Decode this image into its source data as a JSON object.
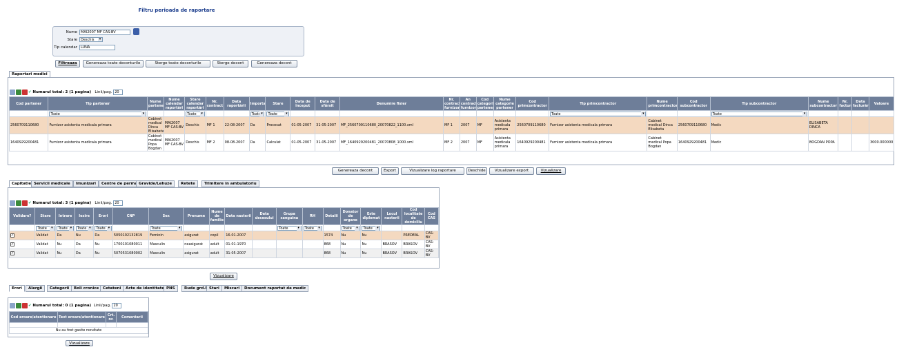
{
  "title": "Filtru perioada de raportare",
  "filter": {
    "nume_label": "Nume",
    "nume_value": "MAI2007 MF CAS-BV",
    "stare_label": "Stare",
    "stare_value": "Deschis",
    "tipcal_label": "Tip calendar",
    "tipcal_value": "LUNA"
  },
  "actions": [
    "Filtreaza",
    "Genereaza toate deconturile",
    "Sterge toate deconturile",
    "Sterge decont",
    "Genereaza decont"
  ],
  "main_tab": "Raportari medici",
  "grid1": {
    "total": "Numarul total: 2 (1 pagina)",
    "linii_label": "Linii/pag.",
    "linii_value": "20",
    "headers": [
      "Cod partener",
      "Tip partener",
      "Nume partener",
      "Nume calendar raportări",
      "Stare calendar raportări",
      "Nr. contract",
      "Data raportării",
      "Importat",
      "Stare",
      "Data de început",
      "Data de sfârsit",
      "Denumire fisier",
      "Nr. contract furnizor",
      "An contract furnizor",
      "Cod categorie partener",
      "Nume categorie partener",
      "Cod primcontractor",
      "Tip primcontractor",
      "Nume primcontractor",
      "Cod subcontractor",
      "Tip subcontractor",
      "Nume subcontractor",
      "Nr. factură",
      "Data facturări",
      "Valoare"
    ],
    "filters": {
      "1": "Toate",
      "4": "Toate",
      "7": "Toate",
      "8": "Toate",
      "17": "Toate",
      "20": "Toate"
    },
    "rows": [
      [
        "2560709110680",
        "Furnizor asistenta medicala primara",
        "Cabinet medical Dinca Elisabeta",
        "MAI2007 MF CAS-BV",
        "Deschis",
        "MF 1",
        "22-08-2007",
        "Da",
        "Procesat",
        "01-05-2007",
        "31-05-2007",
        "MF_2560709110680_20070822_1100.xml",
        "MF 1",
        "2007",
        "MF",
        "Asistenta medicala primara",
        "2560709110680",
        "Furnizor asistenta medicala primara",
        "Cabinet medical Dinca Elisabeta",
        "2560709110680",
        "Medic",
        "ELISABETA DINCA",
        "",
        "",
        ""
      ],
      [
        "1640929200481",
        "Furnizor asistenta medicala primara",
        "Cabinet medical Popa Bogdan",
        "MAI2007 MF CAS-BV",
        "Deschis",
        "MF 2",
        "08-08-2007",
        "Da",
        "Calculat",
        "01-05-2007",
        "31-05-2007",
        "MF_1640929200481_20070808_1000.xml",
        "MF 2",
        "2007",
        "MF",
        "Asistenta medicala primara",
        "1640929200481",
        "Furnizor asistenta medicala primara",
        "Cabinet medical Popa Bogdan",
        "1640929200481",
        "Medic",
        "BOGDAN POPA",
        "",
        "",
        "3000.000000"
      ]
    ]
  },
  "actions2": [
    "Genereaza decont",
    "Export",
    "Vizualizare log raportare",
    "Deschide",
    "Vizualizare export",
    "Vizualizare"
  ],
  "tabs2": [
    "Capitatie",
    "Servicii medicale",
    "Imunizari",
    "Centre de permanenta",
    "Gravide/Lehuze",
    "Retete",
    "Trimitere in ambulatoriu"
  ],
  "grid2": {
    "total": "Numarul total: 3 (1 pagina)",
    "linii_label": "Linii/pag.",
    "linii_value": "20",
    "headers": [
      "Validare?",
      "Stare",
      "Intrare",
      "Iesire",
      "Erori",
      "CNP",
      "Sex",
      "Prenume",
      "Nume de familie",
      "Data nasterii",
      "Data decesului",
      "Grupa sanguina",
      "RH",
      "Detalii",
      "Donator de organe",
      "Este diplomat",
      "Locul nasterii",
      "Cod localitate de domiciliu",
      "Cod CAS"
    ],
    "filters": {
      "1": "Toate",
      "2": "Toate",
      "3": "Toate",
      "4": "Toate",
      "6": "Toate",
      "11": "Toate",
      "12": "Toate",
      "14": "Toate",
      "15": "Toate"
    },
    "rows": [
      [
        "✓",
        "Validat",
        "Da",
        "Nu",
        "Da",
        "5050102132819",
        "Feminin",
        "asigurat",
        "copil",
        "16-01-2007",
        "",
        "",
        "",
        "1574",
        "Nu",
        "Nu",
        "",
        "PREDEAL",
        "CAS-BV"
      ],
      [
        "✓",
        "Validat",
        "Nu",
        "Da",
        "Nu",
        "1700101080011",
        "Masculin",
        "neasigurat",
        "adult",
        "01-01-1970",
        "",
        "",
        "",
        "868",
        "Nu",
        "Nu",
        "BRASOV",
        "BRASOV",
        "CAS-BV"
      ],
      [
        "✓",
        "Validat",
        "Nu",
        "Da",
        "Nu",
        "5070531080002",
        "Masculin",
        "asigurat",
        "adult",
        "31-05-2007",
        "",
        "",
        "",
        "868",
        "Nu",
        "Nu",
        "BRASOV",
        "BRASOV",
        "CAS-BV"
      ]
    ]
  },
  "viz2": "Vizualizare",
  "tabs3": [
    "Erori",
    "Alergii",
    "Categorii",
    "Boli cronice",
    "Cetateni",
    "Acte de identitate",
    "PNS",
    "Rude grd.I",
    "Stari",
    "Miscari",
    "Document raportat de medic"
  ],
  "grid3": {
    "total": "Numarul total: 0 (1 pagina)",
    "linii_label": "Linii/pag.",
    "linii_value": "20",
    "headers": [
      "Cod eroare/atentionare",
      "Text eroare/atentionare",
      "Crt. nr.",
      "Comentarii"
    ],
    "empty": "Nu au fost gasite rezultate"
  },
  "viz3": "Vizualizare"
}
